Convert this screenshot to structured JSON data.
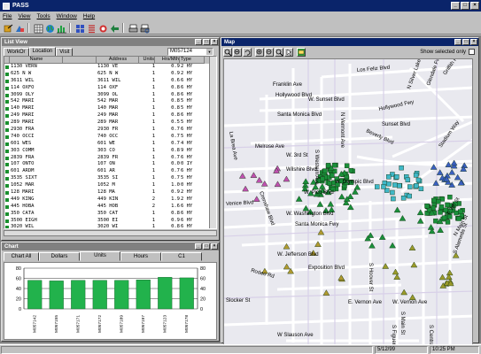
{
  "app": {
    "title": "PASS",
    "window_buttons": [
      "_",
      "□",
      "×"
    ]
  },
  "menu": [
    "File",
    "View",
    "Tools",
    "Window",
    "Help"
  ],
  "list_view": {
    "title": "List View",
    "tabs": [
      "WorkOr",
      "Location",
      "Visit"
    ],
    "selected_tab": "Location",
    "combo_value": "M057124",
    "columns": [
      "",
      "Name",
      "",
      "Address",
      "Units",
      "Hrs/Mth",
      "Type"
    ],
    "rows": [
      [
        "1130 VERN",
        "1130 VE",
        "1",
        "0.9",
        "2 HY"
      ],
      [
        "625 N W",
        "625 N W",
        "1",
        "0.9",
        "2 HY"
      ],
      [
        "3611 WIL",
        "3611 WIL",
        "1",
        "0.6",
        "6 HY"
      ],
      [
        "114 OXFO",
        "114 OXF",
        "1",
        "0.8",
        "6 HY"
      ],
      [
        "3099 OLY",
        "3099 OL",
        "1",
        "0.8",
        "6 HY"
      ],
      [
        "542 MARI",
        "542 MAR",
        "1",
        "0.8",
        "5 HY"
      ],
      [
        "140 MARI",
        "140 MAR",
        "1",
        "0.8",
        "5 HY"
      ],
      [
        "249 MARI",
        "249 MAR",
        "1",
        "0.8",
        "6 HY"
      ],
      [
        "289 MARI",
        "289 MAR",
        "1",
        "0.5",
        "5 HY"
      ],
      [
        "2930 FRA",
        "2930 FR",
        "1",
        "0.7",
        "6 HY"
      ],
      [
        "740 OCCI",
        "740 OCC",
        "1",
        "0.7",
        "5 HY"
      ],
      [
        "601 WES",
        "601 WE",
        "1",
        "0.7",
        "4 HY"
      ],
      [
        "303 COMM",
        "303 CO",
        "1",
        "0.8",
        "9 HY"
      ],
      [
        "2839 FRA",
        "2839 FR",
        "1",
        "0.7",
        "6 HY"
      ],
      [
        "107 ONTO",
        "107 ON",
        "1",
        "0.0",
        "0 IY"
      ],
      [
        "601 ARDM",
        "601 AR",
        "1",
        "0.7",
        "6 HY"
      ],
      [
        "3535 SIXT",
        "3535 SI",
        "1",
        "0.7",
        "5 HY"
      ],
      [
        "1052 MAR",
        "1052 M",
        "1",
        "1.0",
        "0 HY"
      ],
      [
        "128 MARI",
        "128 MA",
        "1",
        "0.9",
        "2 HY"
      ],
      [
        "449 KING",
        "449 KIN",
        "2",
        "1.9",
        "2 HY"
      ],
      [
        "445 HOBA",
        "445 HOB",
        "2",
        "1.6",
        "6 HY"
      ],
      [
        "350 CATA",
        "350 CAT",
        "1",
        "0.8",
        "6 HY"
      ],
      [
        "3500 EIGH",
        "3500 EI",
        "1",
        "0.9",
        "6 HY"
      ],
      [
        "3020 WIL",
        "3020 WI",
        "1",
        "0.8",
        "6 HY"
      ]
    ]
  },
  "chart_window": {
    "title": "Chart",
    "tabs": [
      "Chart All",
      "Dollars",
      "Units",
      "Hours",
      "C1"
    ],
    "selected_tab": "Units"
  },
  "chart_data": {
    "type": "bar",
    "categories": [
      "M057142",
      "M057155",
      "M057171",
      "M057172",
      "M057189",
      "M057197",
      "M057123",
      "M057178"
    ],
    "values": [
      56,
      55,
      56,
      56,
      56,
      57,
      62,
      61
    ],
    "ylim": [
      0,
      80
    ],
    "yticks": [
      0,
      20,
      40,
      60,
      80
    ],
    "color": "#22b24c",
    "grid": true
  },
  "map": {
    "title": "Map",
    "show_selected_label": "Show selected only",
    "street_labels": [
      "Los Feliz Blvd",
      "Franklin Ave",
      "Hollywood Blvd",
      "W. Sunset Blvd",
      "Santa Monica Blvd",
      "Melrose Ave",
      "W. 3rd St",
      "Wilshire Blvd",
      "W. Olympic Blvd",
      "W. Pico Blvd",
      "Venice Blvd",
      "W. Washington Blvd",
      "Santa Monica Fwy",
      "W. Jefferson Blvd",
      "Exposition Blvd",
      "Rodeo Rd",
      "W. Vernon Ave",
      "E. Vernon Ave",
      "Slocker St",
      "W Slauson Ave",
      "Beverly Blvd",
      "Hollywood Fwy",
      "Glendale Fwy",
      "La Brea Ave",
      "N Vermont Ave",
      "S Western Ave",
      "S Hoover St",
      "S Figueroa St",
      "S Main St",
      "S Central Ave",
      "S Alameda St",
      "E 7th St",
      "Crenshaw Blvd",
      "N Silver Lake Blvd",
      "Griffith Park Blvd",
      "Sunset Blvd",
      "Stadium Way",
      "N Main St"
    ]
  },
  "status": {
    "date": "5/12/99",
    "time": "10:25 PM"
  }
}
